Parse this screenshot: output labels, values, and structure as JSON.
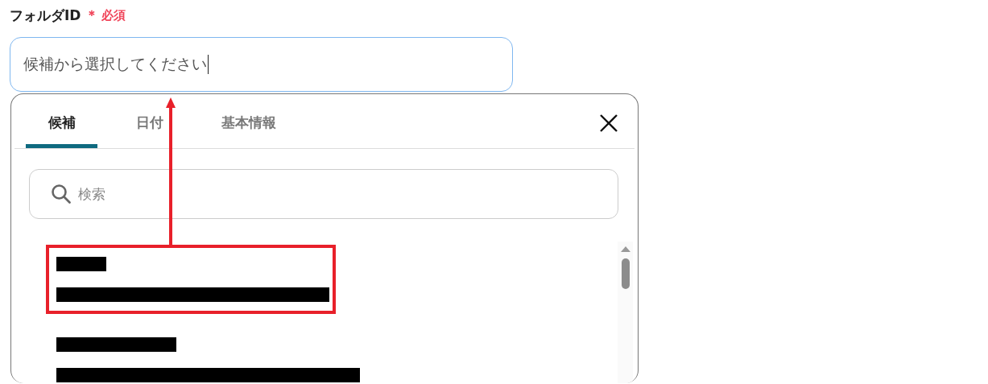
{
  "field": {
    "label": "フォルダID",
    "required_mark": "＊",
    "required_text": "必須",
    "value": "候補から選択してください",
    "focused": true
  },
  "picker": {
    "tabs": [
      {
        "label": "候補",
        "selected": true
      },
      {
        "label": "日付",
        "selected": false
      },
      {
        "label": "基本情報",
        "selected": false
      }
    ],
    "search": {
      "placeholder": "検索"
    },
    "options": [
      {
        "kind": "redacted",
        "annotated": true
      },
      {
        "kind": "redacted",
        "annotated": false
      }
    ]
  }
}
